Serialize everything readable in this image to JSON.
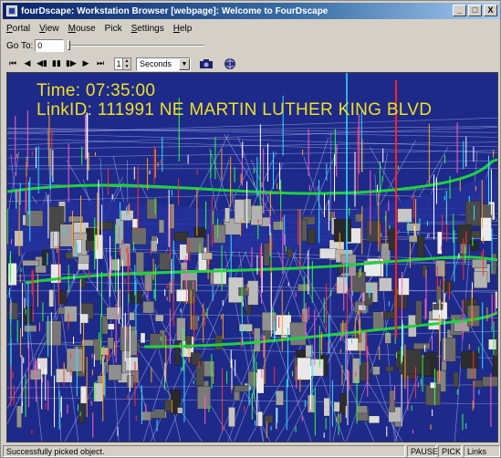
{
  "window": {
    "title": "fourDscape: Workstation Browser [webpage]: Welcome to FourDscape",
    "minimize": "_",
    "maximize": "□",
    "close": "X"
  },
  "menu": {
    "items": [
      {
        "label": "Portal",
        "key": "P",
        "rest": "ortal"
      },
      {
        "label": "View",
        "key": "V",
        "rest": "iew"
      },
      {
        "label": "Mouse",
        "key": "M",
        "rest": "ouse"
      },
      {
        "label": "Pick",
        "key": "P",
        "rest": "ick"
      },
      {
        "label": "Settings",
        "key": "S",
        "rest": "ettings"
      },
      {
        "label": "Help",
        "key": "H",
        "rest": "elp"
      }
    ]
  },
  "goto": {
    "label": "Go To:",
    "value": "0",
    "slider_fraction": 0.0
  },
  "toolbar": {
    "buttons": [
      "⏮",
      "◀",
      "◀▮",
      "▮▮",
      "▮▶",
      "▶",
      "⏭"
    ],
    "step_value": "1",
    "units": "Seconds"
  },
  "icons": {
    "camera": "camera-icon",
    "globe": "globe-icon"
  },
  "hud": {
    "time": "Time: 07:35:00",
    "link": "LinkID: 111991  NE MARTIN LUTHER KING BLVD"
  },
  "colors": {
    "hud_text": "#f0e020",
    "viewport_bg": "#1e2a8a",
    "highlight_road": "#20d040"
  },
  "status": {
    "message": "Successfully picked object.",
    "pause": "PAUSE",
    "pick": "PICK",
    "links": "Links"
  }
}
